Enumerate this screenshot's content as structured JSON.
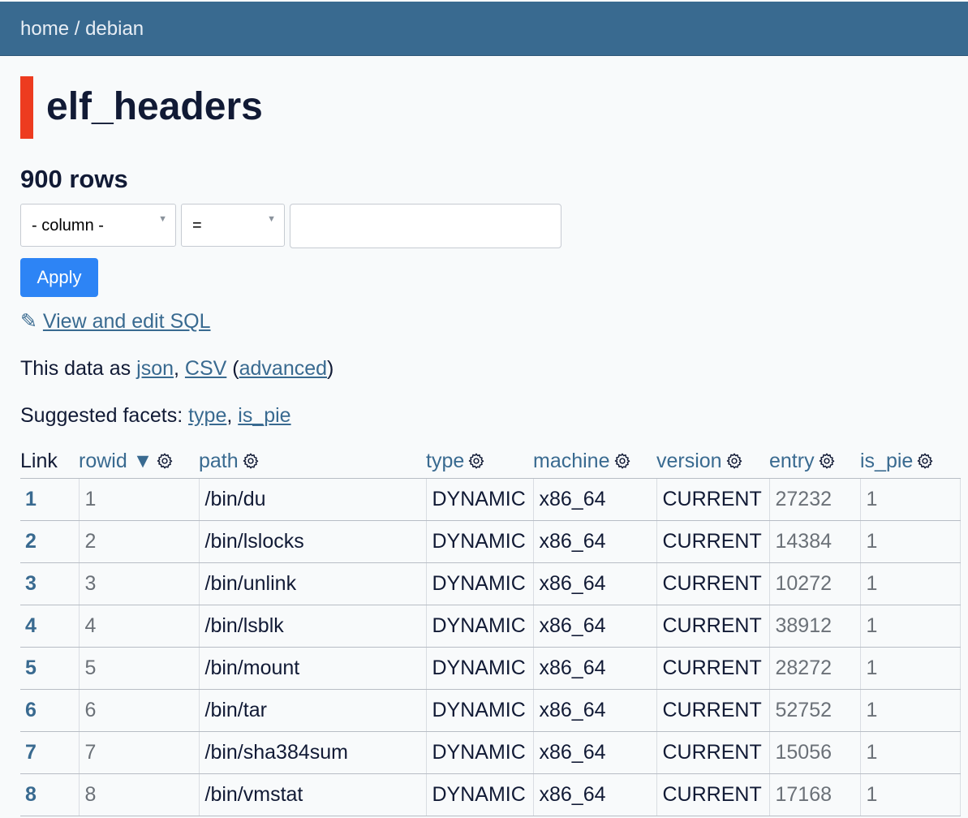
{
  "breadcrumb": {
    "home": "home",
    "sep": " / ",
    "db": "debian"
  },
  "title": "elf_headers",
  "row_count": "900 rows",
  "filter": {
    "column_select": "- column -",
    "op_select": "=",
    "value_input": "",
    "apply_label": "Apply"
  },
  "sql_link": {
    "icon": "✎",
    "label": "View and edit SQL"
  },
  "export": {
    "prefix": "This data as ",
    "json": "json",
    "comma": ", ",
    "csv": "CSV",
    "open": " (",
    "advanced": "advanced",
    "close": ")"
  },
  "facets": {
    "prefix": "Suggested facets: ",
    "items": [
      "type",
      "is_pie"
    ],
    "comma": ", "
  },
  "table": {
    "columns": {
      "link": "Link",
      "rowid": "rowid ▼",
      "path": "path",
      "type": "type",
      "machine": "machine",
      "version": "version",
      "entry": "entry",
      "is_pie": "is_pie"
    },
    "rows": [
      {
        "link": "1",
        "rowid": "1",
        "path": "/bin/du",
        "type": "DYNAMIC",
        "machine": "x86_64",
        "version": "CURRENT",
        "entry": "27232",
        "is_pie": "1"
      },
      {
        "link": "2",
        "rowid": "2",
        "path": "/bin/lslocks",
        "type": "DYNAMIC",
        "machine": "x86_64",
        "version": "CURRENT",
        "entry": "14384",
        "is_pie": "1"
      },
      {
        "link": "3",
        "rowid": "3",
        "path": "/bin/unlink",
        "type": "DYNAMIC",
        "machine": "x86_64",
        "version": "CURRENT",
        "entry": "10272",
        "is_pie": "1"
      },
      {
        "link": "4",
        "rowid": "4",
        "path": "/bin/lsblk",
        "type": "DYNAMIC",
        "machine": "x86_64",
        "version": "CURRENT",
        "entry": "38912",
        "is_pie": "1"
      },
      {
        "link": "5",
        "rowid": "5",
        "path": "/bin/mount",
        "type": "DYNAMIC",
        "machine": "x86_64",
        "version": "CURRENT",
        "entry": "28272",
        "is_pie": "1"
      },
      {
        "link": "6",
        "rowid": "6",
        "path": "/bin/tar",
        "type": "DYNAMIC",
        "machine": "x86_64",
        "version": "CURRENT",
        "entry": "52752",
        "is_pie": "1"
      },
      {
        "link": "7",
        "rowid": "7",
        "path": "/bin/sha384sum",
        "type": "DYNAMIC",
        "machine": "x86_64",
        "version": "CURRENT",
        "entry": "15056",
        "is_pie": "1"
      },
      {
        "link": "8",
        "rowid": "8",
        "path": "/bin/vmstat",
        "type": "DYNAMIC",
        "machine": "x86_64",
        "version": "CURRENT",
        "entry": "17168",
        "is_pie": "1"
      }
    ]
  },
  "colors": {
    "header_bg": "#396a90",
    "accent": "#ed3b1f",
    "button": "#2d84f5",
    "link": "#396a90"
  }
}
